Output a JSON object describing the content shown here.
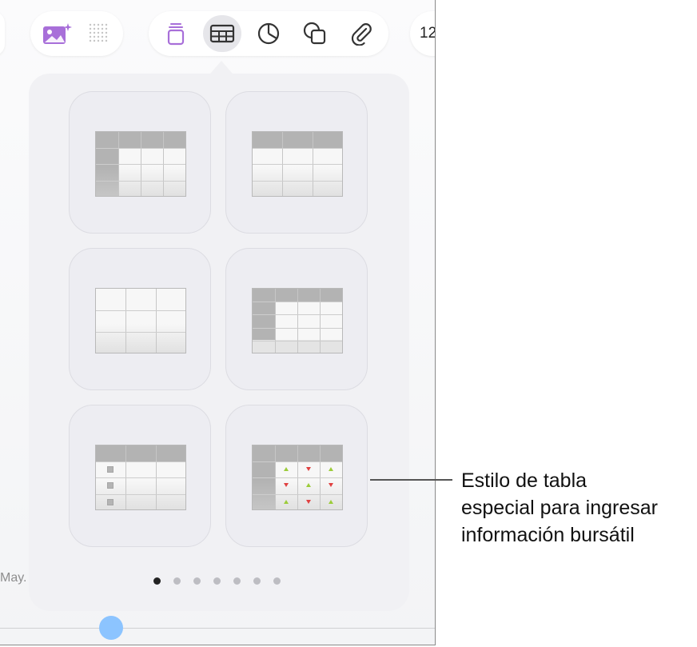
{
  "toolbar": {
    "zoom_label": "12",
    "buttons": [
      {
        "icon": "photo-sparkle-icon"
      },
      {
        "icon": "dot-grid-icon"
      },
      {
        "icon": "text-box-icon"
      },
      {
        "icon": "table-icon",
        "selected": true
      },
      {
        "icon": "pie-chart-icon"
      },
      {
        "icon": "shapes-icon"
      },
      {
        "icon": "paperclip-icon"
      }
    ],
    "accent_color": "#a86fd9"
  },
  "popover": {
    "table_styles": [
      {
        "name": "header-row-and-column"
      },
      {
        "name": "header-row"
      },
      {
        "name": "plain"
      },
      {
        "name": "header-row-column-footer"
      },
      {
        "name": "checklist"
      },
      {
        "name": "stock"
      }
    ],
    "page_count": 7,
    "active_page": 1
  },
  "background": {
    "month_label": "May."
  },
  "callout": {
    "lines": [
      "Estilo de tabla",
      "especial para ingresar",
      "información bursátil"
    ]
  },
  "colors": {
    "stock_up": "#9ccc3a",
    "stock_down": "#e04040",
    "slider_knob": "#8cc4ff"
  }
}
